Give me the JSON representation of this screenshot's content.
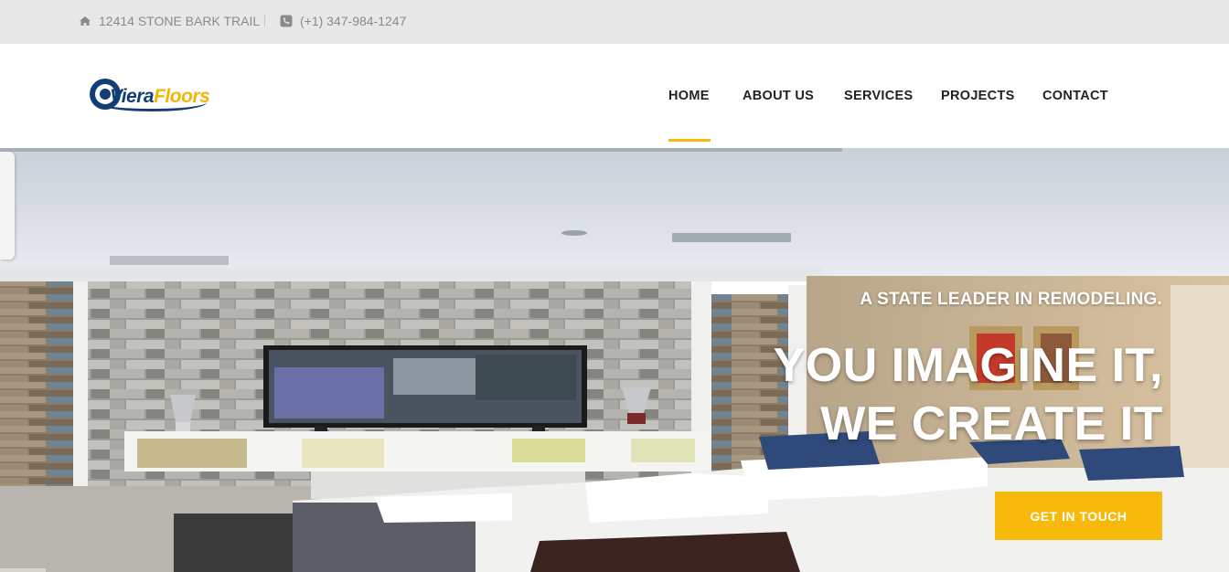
{
  "topbar": {
    "address": "12414 STONE BARK TRAIL",
    "phone": "(+1) 347-984-1247",
    "address_icon": "home-icon",
    "phone_icon": "phone-icon"
  },
  "logo": {
    "part1": "Viera",
    "part2": "Floors"
  },
  "nav": {
    "items": [
      {
        "label": "HOME",
        "active": true
      },
      {
        "label": "ABOUT US"
      },
      {
        "label": "SERVICES"
      },
      {
        "label": "PROJECTS"
      },
      {
        "label": "CONTACT"
      }
    ]
  },
  "hero": {
    "subtitle": "A STATE LEADER IN REMODELING.",
    "title_line1": "YOU IMAGINE IT,",
    "title_line2": "WE CREATE IT",
    "cta_label": "GET IN TOUCH"
  },
  "colors": {
    "accent": "#f7b90b",
    "brand_blue": "#123e78",
    "topbar_bg": "#e8e8e8",
    "text_gray": "#8a8a8a"
  }
}
